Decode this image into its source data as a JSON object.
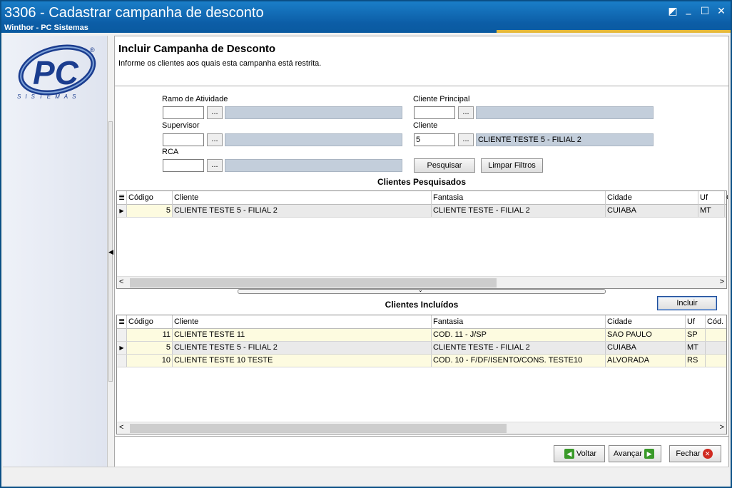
{
  "window": {
    "title": "3306 - Cadastrar campanha de desconto",
    "subtitle": "Winthor - PC Sistemas",
    "controls": [
      "◩",
      "_",
      "☐",
      "✕"
    ]
  },
  "logo": {
    "brand": "PC",
    "sub": "SISTEMAS",
    "reg": "®"
  },
  "header": {
    "title": "Incluir Campanha de Desconto",
    "description": "Informe os clientes aos quais esta campanha está restrita."
  },
  "filters": {
    "ramo_label": "Ramo de Atividade",
    "ramo_value": "",
    "ramo_desc": "",
    "supervisor_label": "Supervisor",
    "supervisor_value": "",
    "supervisor_desc": "",
    "rca_label": "RCA",
    "rca_value": "",
    "rca_desc": "",
    "cliente_principal_label": "Cliente Principal",
    "cliente_principal_value": "",
    "cliente_principal_desc": "",
    "cliente_label": "Cliente",
    "cliente_value": "5",
    "cliente_desc": "CLIENTE TESTE 5  - FILIAL 2",
    "ellipsis": "...",
    "pesquisar": "Pesquisar",
    "limpar": "Limpar Filtros"
  },
  "searched": {
    "title": "Clientes Pesquisados",
    "columns": [
      "Código",
      "Cliente",
      "Fantasia",
      "Cidade",
      "Uf",
      "C"
    ],
    "rows": [
      {
        "codigo": "5",
        "cliente": "CLIENTE TESTE 5  - FILIAL 2",
        "fantasia": "CLIENTE TESTE - FILIAL 2",
        "cidade": "CUIABA",
        "uf": "MT",
        "current": true
      }
    ]
  },
  "included": {
    "title": "Clientes Incluídos",
    "incluir": "Incluir",
    "columns": [
      "Código",
      "Cliente",
      "Fantasia",
      "Cidade",
      "Uf",
      "Cód. F"
    ],
    "rows": [
      {
        "codigo": "11",
        "cliente": "CLIENTE TESTE 11",
        "fantasia": "COD. 11 - J/SP",
        "cidade": "SAO PAULO",
        "uf": "SP",
        "current": false
      },
      {
        "codigo": "5",
        "cliente": "CLIENTE TESTE 5  - FILIAL 2",
        "fantasia": "CLIENTE TESTE - FILIAL 2",
        "cidade": "CUIABA",
        "uf": "MT",
        "current": true
      },
      {
        "codigo": "10",
        "cliente": "CLIENTE TESTE 10 TESTE",
        "fantasia": "COD. 10 - F/DF/ISENTO/CONS. TESTE10",
        "cidade": "ALVORADA",
        "uf": "RS",
        "current": false
      }
    ]
  },
  "footer": {
    "voltar": "Voltar",
    "avancar": "Avançar",
    "fechar": "Fechar"
  },
  "colors": {
    "title_bar": "#0c5da6",
    "accent": "#e6b93a",
    "row_yellow": "#fdfbe0",
    "readonly": "#c3cedb"
  }
}
